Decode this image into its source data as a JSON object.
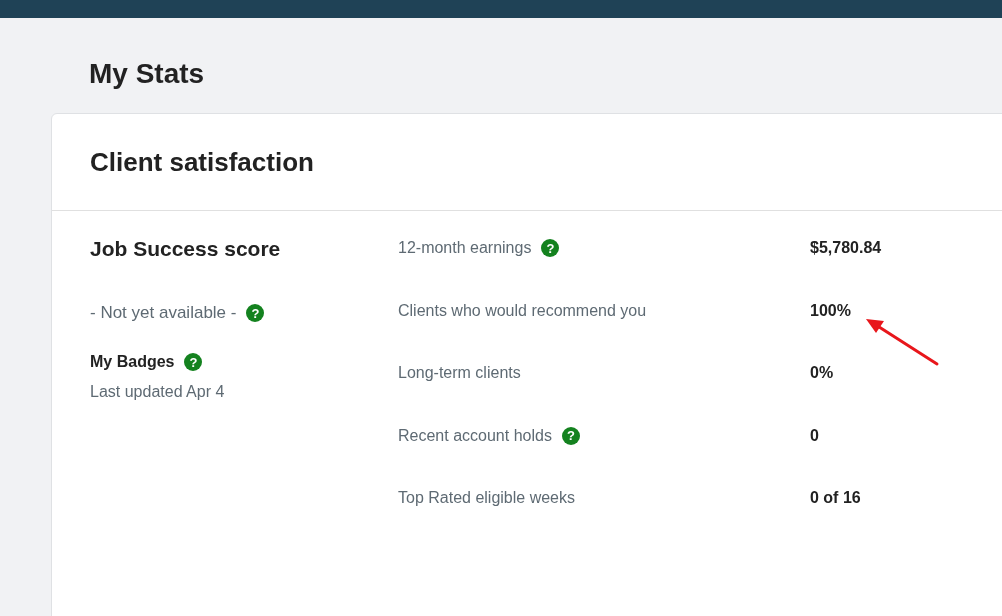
{
  "page_title": "My Stats",
  "card": {
    "title": "Client satisfaction",
    "job_success": {
      "title": "Job Success score",
      "status": "- Not yet available -",
      "help": true
    },
    "badges": {
      "title": "My Badges",
      "help": true,
      "updated": "Last updated Apr 4"
    },
    "help_glyph": "?",
    "stats": [
      {
        "label": "12-month earnings",
        "help": true,
        "value": "$5,780.84"
      },
      {
        "label": "Clients who would recommend you",
        "help": false,
        "value": "100%"
      },
      {
        "label": "Long-term clients",
        "help": false,
        "value": "0%"
      },
      {
        "label": "Recent account holds",
        "help": true,
        "value": "0"
      },
      {
        "label": "Top Rated eligible weeks",
        "help": false,
        "value": "0 of 16"
      }
    ]
  }
}
